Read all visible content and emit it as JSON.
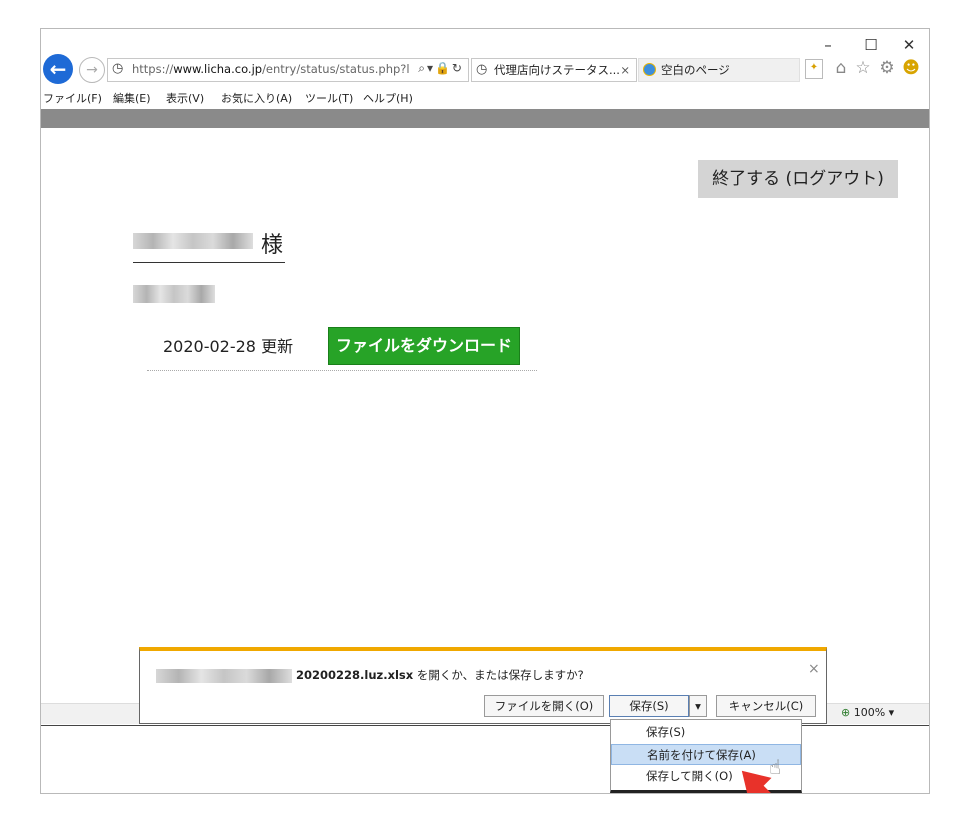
{
  "browser": {
    "address_url_prefix": "https://",
    "address_url_domain": "www.licha.co.jp",
    "address_url_path": "/entry/status/status.php?l",
    "tabs": [
      {
        "label": "代理店向けステータス...",
        "active": true
      },
      {
        "label": "空白のページ",
        "active": false
      }
    ],
    "tab_close": "×",
    "window_controls": {
      "minimize": "–",
      "maximize": "☐",
      "close": "✕"
    }
  },
  "menubar": {
    "items": [
      "ファイル(F)",
      "編集(E)",
      "表示(V)",
      "お気に入り(A)",
      "ツール(T)",
      "ヘルプ(H)"
    ]
  },
  "page": {
    "logout_label": "終了する (ログアウト)",
    "honorific": "様",
    "update_text": "2020-02-28 更新",
    "download_label": "ファイルをダウンロード"
  },
  "notification": {
    "filename": "20200228.luz.xlsx",
    "prompt": " を開くか、または保存しますか?",
    "open_label": "ファイルを開く(O)",
    "save_label": "保存(S)",
    "cancel_label": "キャンセル(C)",
    "close": "×",
    "zoom": "100%"
  },
  "save_menu": {
    "items": [
      {
        "label": "保存(S)",
        "highlighted": false
      },
      {
        "label": "名前を付けて保存(A)",
        "highlighted": true
      },
      {
        "label": "保存して開く(O)",
        "highlighted": false
      }
    ]
  },
  "colors": {
    "download_button": "#27a327",
    "notification_accent": "#f0a800",
    "highlight": "#c9def5",
    "pointer_arrow": "#e8322a",
    "back_button": "#1e6ad6"
  }
}
